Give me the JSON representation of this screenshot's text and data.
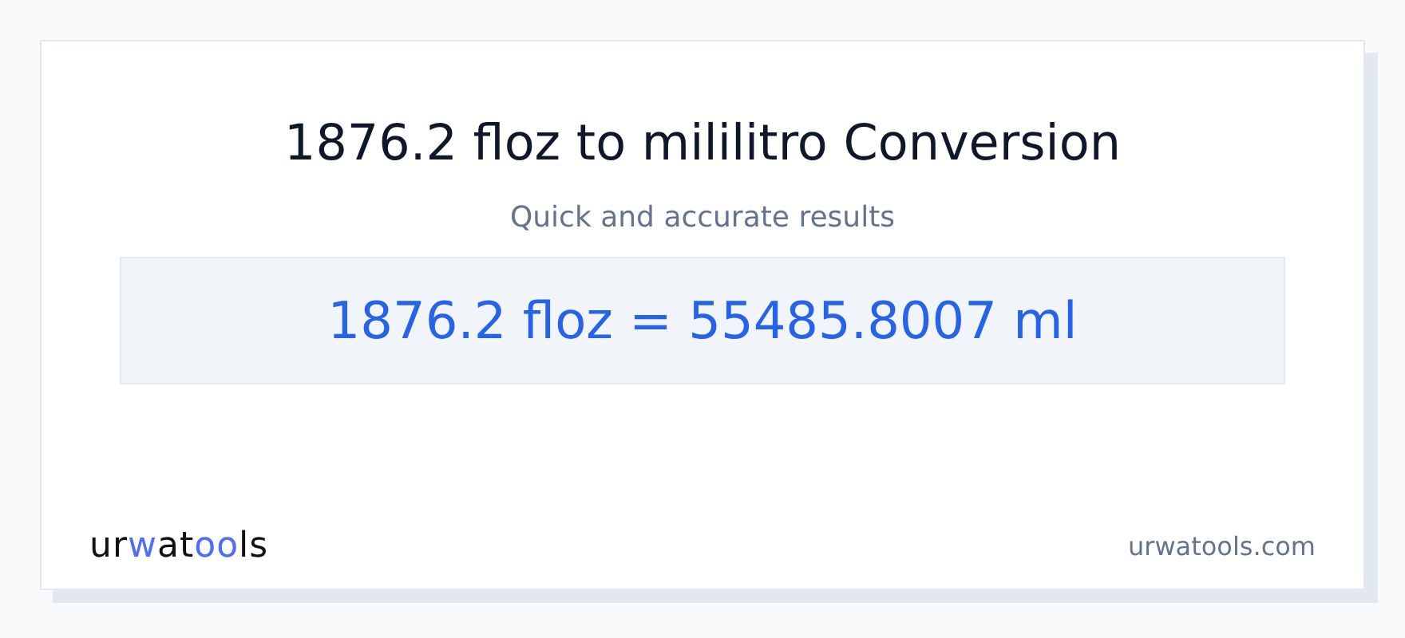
{
  "title": "1876.2 floz to mililitro Conversion",
  "subtitle": "Quick and accurate results",
  "result": "1876.2 floz = 55485.8007 ml",
  "footer": {
    "logo": [
      {
        "text": "ur",
        "accent": false
      },
      {
        "text": "w",
        "accent": true
      },
      {
        "text": "at",
        "accent": false
      },
      {
        "text": "oo",
        "accent": true
      },
      {
        "text": "ls",
        "accent": false
      }
    ],
    "site": "urwatools.com"
  }
}
